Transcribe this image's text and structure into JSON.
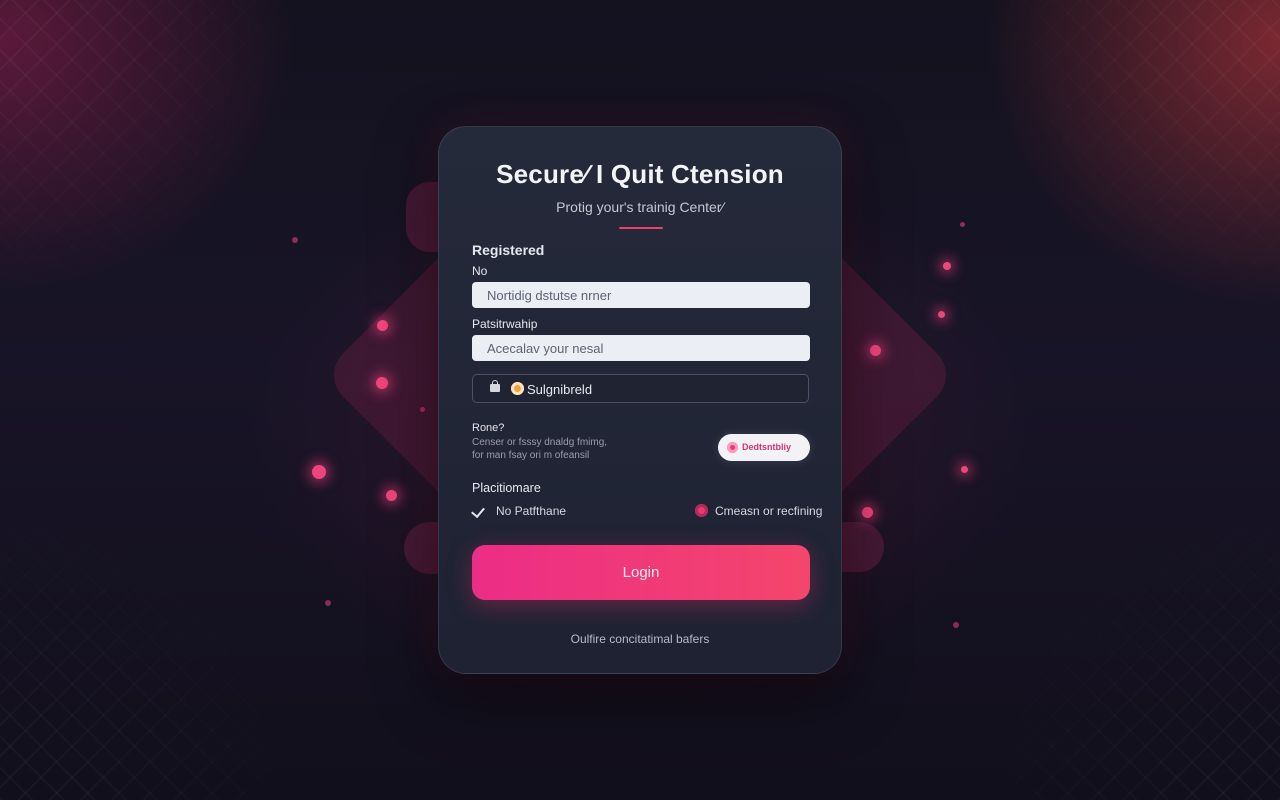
{
  "colors": {
    "accent": "#ec2d86",
    "card_background": "#232837",
    "page_background": "#14121f"
  },
  "card": {
    "title": "Secure∕ I Quit Ctension",
    "subtitle": "Protig your's trainig Center∕"
  },
  "form": {
    "section_label": "Registered",
    "field1_label": "No",
    "field1_placeholder": "Nortidig dstutse nrner",
    "field2_label": "Patsitrwahip",
    "field2_placeholder": "Acecalav your nesal",
    "field3_icon": "lock-icon",
    "field3_badge_icon": "badge-icon",
    "field3_text": "Sulgnibreld",
    "info_heading": "Rone?",
    "info_line1": "Censer or fsssy dnaldg fmimg,",
    "info_line2": "for man fsay ori m ofeansil",
    "pill_label": "Dedtsntbliy",
    "options_heading": "Placitiomare",
    "option_left": "No Patfthane",
    "option_right": "Cmeasn or recfining",
    "login_label": "Login",
    "footer_link": "Oulfire concitatimal bafers"
  }
}
